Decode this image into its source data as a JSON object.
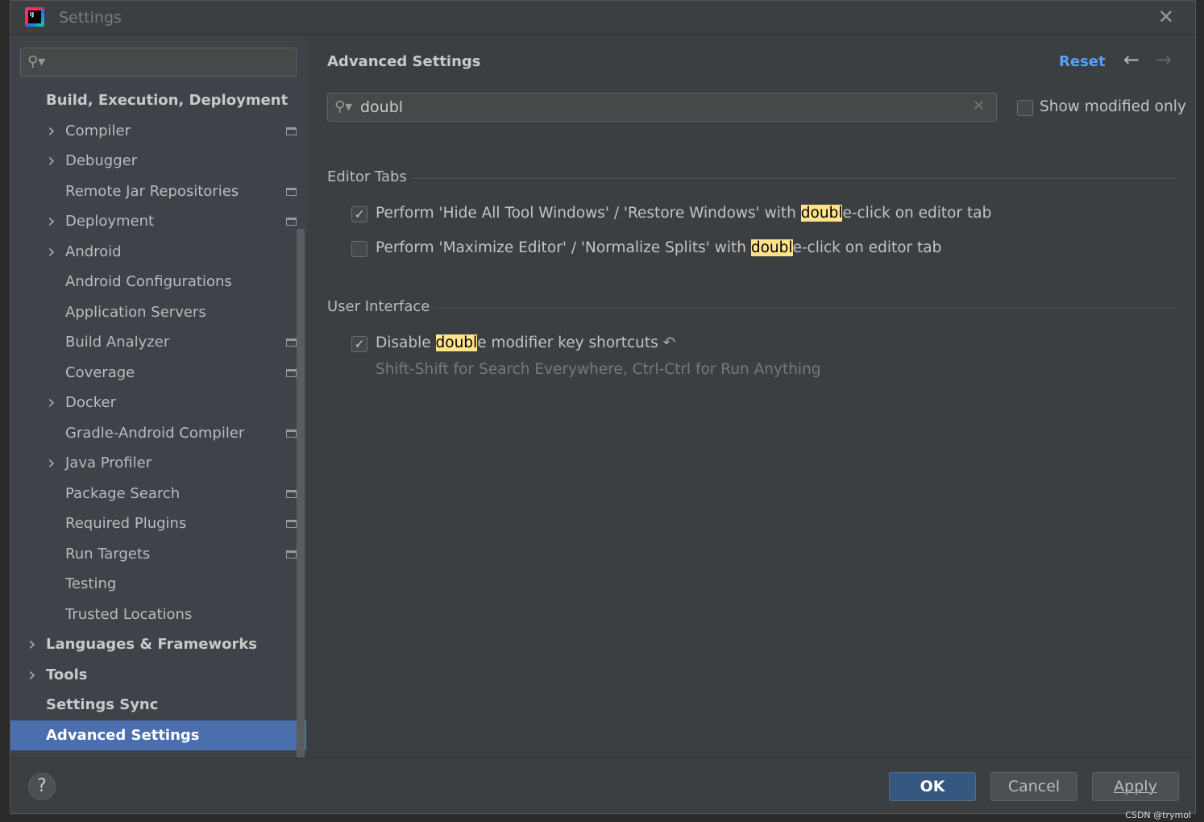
{
  "window": {
    "title": "Settings",
    "close_icon": "close-icon"
  },
  "sidebar": {
    "search_placeholder": "",
    "items": [
      {
        "label": "Build, Execution, Deployment",
        "bold": true,
        "indent": 0,
        "chevron": false,
        "project": false
      },
      {
        "label": "Compiler",
        "indent": 1,
        "chevron": true,
        "project": true
      },
      {
        "label": "Debugger",
        "indent": 1,
        "chevron": true,
        "project": false
      },
      {
        "label": "Remote Jar Repositories",
        "indent": 1,
        "chevron": false,
        "project": true
      },
      {
        "label": "Deployment",
        "indent": 1,
        "chevron": true,
        "project": true
      },
      {
        "label": "Android",
        "indent": 1,
        "chevron": true,
        "project": false
      },
      {
        "label": "Android Configurations",
        "indent": 1,
        "chevron": false,
        "project": false
      },
      {
        "label": "Application Servers",
        "indent": 1,
        "chevron": false,
        "project": false
      },
      {
        "label": "Build Analyzer",
        "indent": 1,
        "chevron": false,
        "project": true
      },
      {
        "label": "Coverage",
        "indent": 1,
        "chevron": false,
        "project": true
      },
      {
        "label": "Docker",
        "indent": 1,
        "chevron": true,
        "project": false
      },
      {
        "label": "Gradle-Android Compiler",
        "indent": 1,
        "chevron": false,
        "project": true
      },
      {
        "label": "Java Profiler",
        "indent": 1,
        "chevron": true,
        "project": false
      },
      {
        "label": "Package Search",
        "indent": 1,
        "chevron": false,
        "project": true
      },
      {
        "label": "Required Plugins",
        "indent": 1,
        "chevron": false,
        "project": true
      },
      {
        "label": "Run Targets",
        "indent": 1,
        "chevron": false,
        "project": true
      },
      {
        "label": "Testing",
        "indent": 1,
        "chevron": false,
        "project": false
      },
      {
        "label": "Trusted Locations",
        "indent": 1,
        "chevron": false,
        "project": false
      },
      {
        "label": "Languages & Frameworks",
        "bold": true,
        "indent": 0,
        "chevron": true,
        "project": false
      },
      {
        "label": "Tools",
        "bold": true,
        "indent": 0,
        "chevron": true,
        "project": false
      },
      {
        "label": "Settings Sync",
        "bold": true,
        "indent": 0,
        "chevron": false,
        "project": false
      },
      {
        "label": "Advanced Settings",
        "bold": true,
        "indent": 0,
        "chevron": false,
        "project": false,
        "selected": true
      }
    ]
  },
  "main": {
    "title": "Advanced Settings",
    "reset": "Reset",
    "search_value": "doubl",
    "show_modified_only": {
      "label": "Show modified only",
      "checked": false
    },
    "sections": [
      {
        "title": "Editor Tabs",
        "options": [
          {
            "pre": "Perform 'Hide All Tool Windows' / 'Restore Windows' with ",
            "match": "doubl",
            "post": "e-click on editor tab",
            "checked": true
          },
          {
            "pre": "Perform 'Maximize Editor' / 'Normalize Splits' with ",
            "match": "doubl",
            "post": "e-click on editor tab",
            "checked": false
          }
        ]
      },
      {
        "title": "User Interface",
        "options": [
          {
            "pre": "Disable ",
            "match": "doubl",
            "post": "e modifier key shortcuts",
            "checked": true,
            "modified": true,
            "description": "Shift-Shift for Search Everywhere, Ctrl-Ctrl for Run Anything"
          }
        ]
      }
    ]
  },
  "footer": {
    "help": "?",
    "ok": "OK",
    "cancel": "Cancel",
    "apply": "Apply",
    "watermark": "CSDN @trymol"
  },
  "colors": {
    "accent": "#589df6",
    "selection": "#4b6eaf",
    "highlight": "#ffe28c",
    "ok_button": "#365880"
  }
}
